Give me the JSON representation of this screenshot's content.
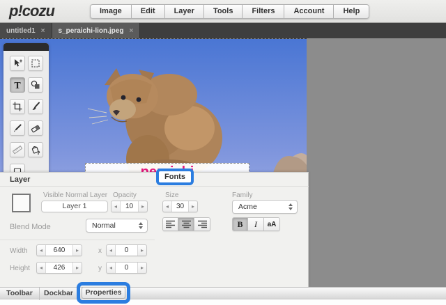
{
  "header": {
    "logo": "p!cozu",
    "menu": [
      "Image",
      "Edit",
      "Layer",
      "Tools",
      "Filters",
      "Account",
      "Help"
    ]
  },
  "tabs": [
    {
      "label": "untitled1",
      "active": false
    },
    {
      "label": "s_peraichi-lion.jpeg",
      "active": true
    }
  ],
  "icons": {
    "close": "×",
    "stepper_prev": "◂",
    "stepper_next": "▸"
  },
  "tools": [
    "move",
    "marquee-select",
    "text",
    "shapes",
    "crop",
    "brush",
    "eyedropper",
    "eraser",
    "ruler",
    "fill"
  ],
  "canvas": {
    "overlay_text": "peraichi"
  },
  "layer_panel": {
    "title": "Layer",
    "visible_label": "Visible Normal Layer",
    "layer_name": "Layer 1",
    "opacity_label": "Opacity",
    "opacity_value": "10",
    "blend_label": "Blend Mode",
    "blend_value": "Normal",
    "width_label": "Width",
    "width_value": "640",
    "x_label": "x",
    "x_value": "0",
    "height_label": "Height",
    "height_value": "426",
    "y_label": "y",
    "y_value": "0"
  },
  "fonts_panel": {
    "title": "Fonts",
    "size_label": "Size",
    "size_value": "30",
    "family_label": "Family",
    "family_value": "Acme",
    "bold_label": "B",
    "italic_label": "I",
    "case_label": "aA"
  },
  "bottom_bar": {
    "toolbar": "Toolbar",
    "dockbar": "Dockbar",
    "properties": "Properties"
  },
  "colors": {
    "accent_blue": "#2b7de0",
    "overlay_pink": "#e6187e",
    "workspace_gray": "#8c8c8c"
  }
}
